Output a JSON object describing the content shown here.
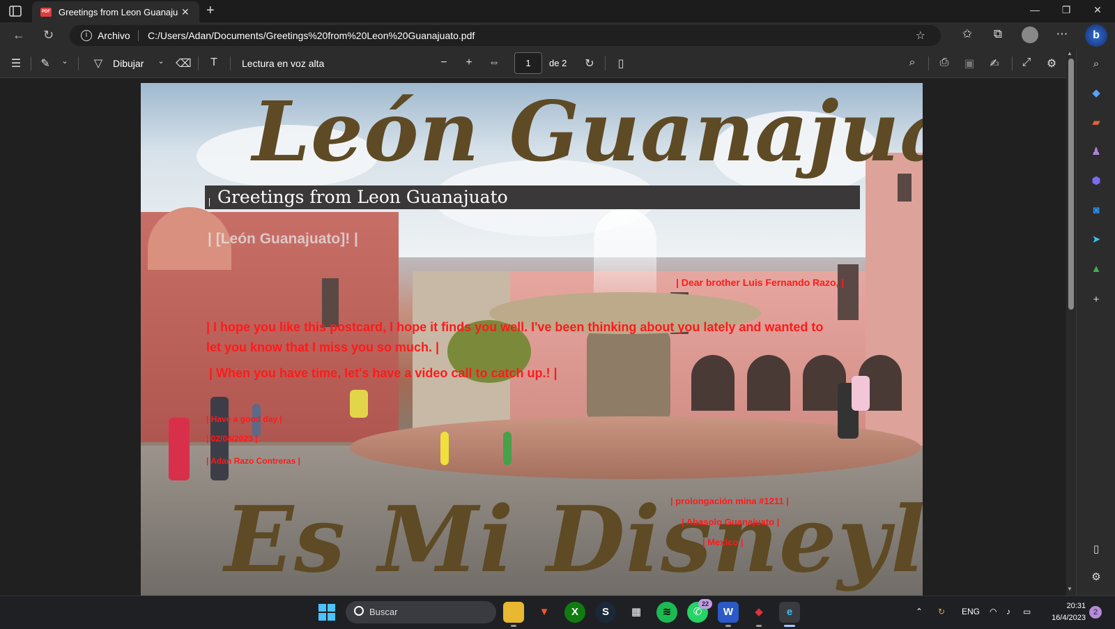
{
  "browser": {
    "tab_title": "Greetings from Leon Guanajuato",
    "tab_favicon_label": "PDF",
    "url_label": "Archivo",
    "url": "C:/Users/Adan/Documents/Greetings%20from%20Leon%20Guanajuato.pdf"
  },
  "pdf_toolbar": {
    "draw_label": "Dibujar",
    "read_aloud_label": "Lectura en voz alta",
    "page_current": "1",
    "page_total_label": "de 2"
  },
  "document": {
    "script_top": "León Guanajuato",
    "header_band": "Greetings from Leon Guanajuato",
    "overlay_gray": "| [León Guanajuato]! |",
    "greeting": "| Dear brother Luis Fernando Razo, |",
    "body_line1": "| I hope you like this postcard, I hope it finds you well. I've been thinking about you lately and wanted to",
    "body_line2": "let you know that I miss you so much. |",
    "body_line3": "| When you have time, let's have a video call to catch up.! |",
    "closing": "| Have a good day |",
    "date": "| 02/04/2023 |",
    "sender": "| Adan Razo Contreras |",
    "address1": "| prolongación mina #1211 |",
    "address2": "| Abasolo Guanajuato |",
    "address3": "| Mexico |",
    "script_bottom": "Es Mi Disneyland"
  },
  "taskbar": {
    "search_label": "Buscar",
    "whatsapp_badge": "22",
    "lang": "ENG",
    "time": "20:31",
    "date": "16/4/2023",
    "notifications": "2"
  },
  "colors": {
    "accent_red": "#ff1a1a",
    "script_brown": "#5e4a24",
    "band": "#3a3838"
  }
}
